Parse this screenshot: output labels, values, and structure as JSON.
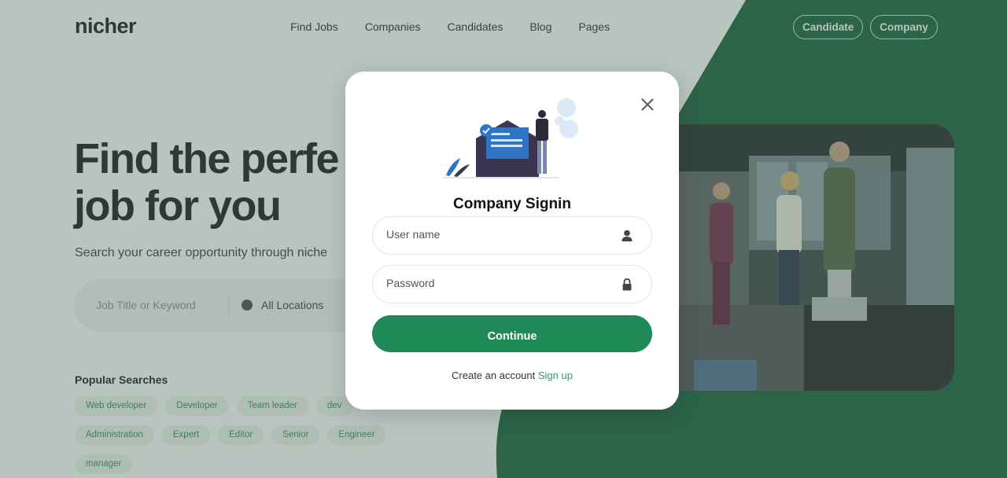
{
  "header": {
    "logo": "nicher",
    "nav": [
      "Find Jobs",
      "Companies",
      "Candidates",
      "Blog",
      "Pages"
    ],
    "buttons": [
      "Candidate",
      "Company"
    ]
  },
  "hero": {
    "title_line1": "Find the perfe",
    "title_line2": "job for you",
    "subtitle": "Search your career opportunity through niche",
    "search": {
      "keyword_placeholder": "Job Title or Keyword",
      "location_label": "All Locations"
    }
  },
  "popular": {
    "title": "Popular Searches",
    "tags": [
      "Web developer",
      "Developer",
      "Team leader",
      "dev",
      "Administration",
      "Expert",
      "Editor",
      "Senior",
      "Engineer",
      "manager"
    ]
  },
  "modal": {
    "title": "Company Signin",
    "username_placeholder": "User name",
    "password_placeholder": "Password",
    "continue_label": "Continue",
    "create_text": "Create an account",
    "signup_label": "Sign up"
  },
  "colors": {
    "brand_green": "#1f8a57",
    "dark_green": "#0f5a34",
    "link_green": "#2f9e64"
  }
}
